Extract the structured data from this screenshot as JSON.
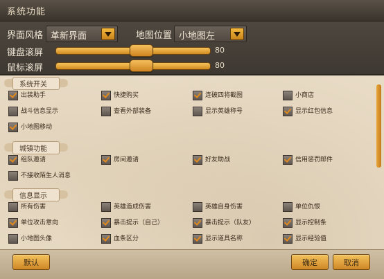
{
  "window": {
    "title": "系统功能"
  },
  "top": {
    "style_label": "界面风格",
    "style_value": "革新界面",
    "map_label": "地图位置",
    "map_value": "小地图左",
    "keyboard_label": "键盘滚屏",
    "keyboard_value": "80",
    "keyboard_level": 0.8,
    "mouse_label": "鼠标滚屏",
    "mouse_value": "80",
    "mouse_level": 0.8
  },
  "sections": [
    {
      "title": "系统开关",
      "items": [
        {
          "label": "出装助手",
          "checked": true
        },
        {
          "label": "快捷购买",
          "checked": true
        },
        {
          "label": "连破四将截图",
          "checked": true
        },
        {
          "label": "小商店",
          "checked": false
        },
        {
          "label": "战斗信息显示",
          "checked": false
        },
        {
          "label": "查看外部装备",
          "checked": false
        },
        {
          "label": "显示英雄称号",
          "checked": false
        },
        {
          "label": "显示红包信息",
          "checked": true
        },
        {
          "label": "小地图移动",
          "checked": true
        }
      ]
    },
    {
      "title": "城镇功能",
      "items": [
        {
          "label": "组队邀请",
          "checked": true
        },
        {
          "label": "房间邀请",
          "checked": true
        },
        {
          "label": "好友助战",
          "checked": true
        },
        {
          "label": "信用惩罚邮件",
          "checked": true
        },
        {
          "label": "不接收陌生人消息",
          "checked": false
        }
      ]
    },
    {
      "title": "信息显示",
      "items": [
        {
          "label": "所有伤害",
          "checked": false
        },
        {
          "label": "英雄造成伤害",
          "checked": false
        },
        {
          "label": "英雄自身伤害",
          "checked": false
        },
        {
          "label": "单位仇恨",
          "checked": false
        },
        {
          "label": "单位攻击意向",
          "checked": true
        },
        {
          "label": "暴击提示（自己）",
          "checked": true
        },
        {
          "label": "暴击提示（队友）",
          "checked": true
        },
        {
          "label": "显示控制条",
          "checked": true
        },
        {
          "label": "小地图头像",
          "checked": false
        },
        {
          "label": "血条区分",
          "checked": true
        },
        {
          "label": "显示道具名称",
          "checked": true
        },
        {
          "label": "显示经验值",
          "checked": true
        }
      ]
    }
  ],
  "buttons": {
    "default": "默认",
    "ok": "确定",
    "cancel": "取消"
  }
}
